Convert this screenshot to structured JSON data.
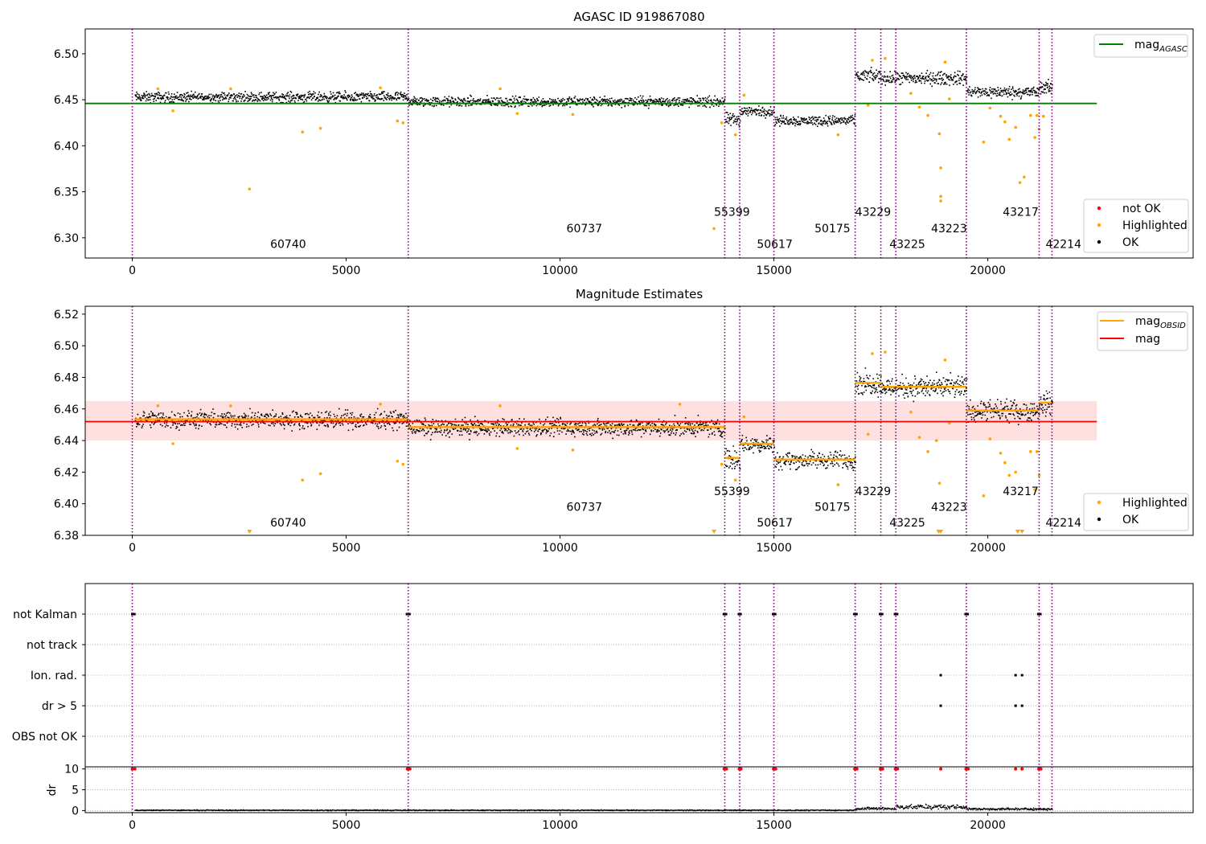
{
  "chart_data": [
    {
      "type": "scatter",
      "title": "AGASC ID 919867080",
      "xlabel": "",
      "ylabel": "",
      "xlim": [
        -1100,
        24800
      ],
      "ylim": [
        6.278,
        6.527
      ],
      "x_ticks": [
        0,
        5000,
        10000,
        15000,
        20000
      ],
      "y_ticks": [
        6.3,
        6.35,
        6.4,
        6.45,
        6.5
      ],
      "grid": false,
      "reference_line": {
        "name": "magAGASC",
        "value": 6.446,
        "color": "#008000",
        "x_range": [
          -1100,
          22550
        ]
      },
      "obsid_boundaries": [
        0,
        6450,
        13850,
        14200,
        15000,
        16900,
        17500,
        17850,
        19500,
        21200,
        21500
      ],
      "obsid_labels": [
        {
          "text": "60740",
          "x": 3225,
          "y": 6.289
        },
        {
          "text": "60737",
          "x": 10150,
          "y": 6.306
        },
        {
          "text": "55399",
          "x": 13600,
          "y": 6.324
        },
        {
          "text": "50617",
          "x": 14600,
          "y": 6.289
        },
        {
          "text": "50175",
          "x": 15950,
          "y": 6.306
        },
        {
          "text": "43229",
          "x": 16900,
          "y": 6.324
        },
        {
          "text": "43225",
          "x": 17700,
          "y": 6.289
        },
        {
          "text": "43223",
          "x": 18675,
          "y": 6.306
        },
        {
          "text": "43217",
          "x": 20350,
          "y": 6.324
        },
        {
          "text": "42214",
          "x": 21350,
          "y": 6.289
        }
      ],
      "segments": [
        {
          "x0": 50,
          "x1": 6450,
          "mean": 6.4535,
          "spread": 0.006
        },
        {
          "x0": 6450,
          "x1": 13850,
          "mean": 6.4485,
          "spread": 0.006
        },
        {
          "x0": 13850,
          "x1": 14200,
          "mean": 6.429,
          "spread": 0.008
        },
        {
          "x0": 14200,
          "x1": 15000,
          "mean": 6.438,
          "spread": 0.006
        },
        {
          "x0": 15000,
          "x1": 16900,
          "mean": 6.428,
          "spread": 0.006
        },
        {
          "x0": 16900,
          "x1": 17500,
          "mean": 6.4765,
          "spread": 0.008
        },
        {
          "x0": 17500,
          "x1": 17850,
          "mean": 6.474,
          "spread": 0.007
        },
        {
          "x0": 17850,
          "x1": 19500,
          "mean": 6.474,
          "spread": 0.008
        },
        {
          "x0": 19500,
          "x1": 21200,
          "mean": 6.459,
          "spread": 0.007
        },
        {
          "x0": 21200,
          "x1": 21500,
          "mean": 6.464,
          "spread": 0.008
        }
      ],
      "highlighted_points": [
        [
          2740,
          6.353
        ],
        [
          3980,
          6.415
        ],
        [
          4400,
          6.419
        ],
        [
          6200,
          6.427
        ],
        [
          6330,
          6.425
        ],
        [
          950,
          6.438
        ],
        [
          13600,
          6.31
        ],
        [
          13780,
          6.425
        ],
        [
          14100,
          6.412
        ],
        [
          14300,
          6.455
        ],
        [
          16500,
          6.412
        ],
        [
          17200,
          6.444
        ],
        [
          18900,
          6.376
        ],
        [
          18900,
          6.345
        ],
        [
          18900,
          6.34
        ],
        [
          18870,
          6.413
        ],
        [
          19100,
          6.451
        ],
        [
          18400,
          6.442
        ],
        [
          18600,
          6.433
        ],
        [
          19900,
          6.404
        ],
        [
          20050,
          6.441
        ],
        [
          20300,
          6.432
        ],
        [
          20400,
          6.426
        ],
        [
          20500,
          6.407
        ],
        [
          20650,
          6.42
        ],
        [
          20750,
          6.36
        ],
        [
          20850,
          6.366
        ],
        [
          21000,
          6.433
        ],
        [
          21100,
          6.409
        ],
        [
          21150,
          6.433
        ],
        [
          21200,
          6.418
        ],
        [
          21300,
          6.432
        ],
        [
          17300,
          6.493
        ],
        [
          17600,
          6.495
        ],
        [
          18200,
          6.457
        ],
        [
          19000,
          6.491
        ],
        [
          9000,
          6.435
        ],
        [
          10300,
          6.434
        ],
        [
          5800,
          6.463
        ],
        [
          600,
          6.462
        ],
        [
          2300,
          6.462
        ],
        [
          8600,
          6.462
        ]
      ],
      "legends": [
        {
          "placement": "upper-right",
          "entries": [
            {
              "label": "magAGASC",
              "kind": "line",
              "color": "#008000"
            }
          ]
        },
        {
          "placement": "lower-right",
          "entries": [
            {
              "label": "not OK",
              "kind": "marker",
              "color": "#ff0000"
            },
            {
              "label": "Highlighted",
              "kind": "marker",
              "color": "#ffa500"
            },
            {
              "label": "OK",
              "kind": "marker",
              "color": "#000000"
            }
          ]
        }
      ]
    },
    {
      "type": "scatter",
      "title": "Magnitude Estimates",
      "xlabel": "",
      "ylabel": "",
      "xlim": [
        -1100,
        24800
      ],
      "ylim": [
        6.38,
        6.525
      ],
      "x_ticks": [
        0,
        5000,
        10000,
        15000,
        20000
      ],
      "y_ticks": [
        6.38,
        6.4,
        6.42,
        6.44,
        6.46,
        6.48,
        6.5,
        6.52
      ],
      "grid": false,
      "mag_line": {
        "name": "mag",
        "value": 6.452,
        "color": "#ff0000",
        "band": [
          6.44,
          6.465
        ],
        "x_range": [
          -1100,
          22550
        ]
      },
      "obsid_boundaries": [
        0,
        6450,
        13850,
        14200,
        15000,
        16900,
        17500,
        17850,
        19500,
        21200,
        21500
      ],
      "obsid_labels": [
        {
          "text": "60740",
          "x": 3225,
          "y": 6.3855
        },
        {
          "text": "60737",
          "x": 10150,
          "y": 6.3955
        },
        {
          "text": "55399",
          "x": 13600,
          "y": 6.4055
        },
        {
          "text": "50617",
          "x": 14600,
          "y": 6.3855
        },
        {
          "text": "50175",
          "x": 15950,
          "y": 6.3955
        },
        {
          "text": "43229",
          "x": 16900,
          "y": 6.4055
        },
        {
          "text": "43225",
          "x": 17700,
          "y": 6.3855
        },
        {
          "text": "43223",
          "x": 18675,
          "y": 6.3955
        },
        {
          "text": "43217",
          "x": 20350,
          "y": 6.4055
        },
        {
          "text": "42214",
          "x": 21350,
          "y": 6.3855
        }
      ],
      "segments": [
        {
          "x0": 50,
          "x1": 6450,
          "mean": 6.4535,
          "spread": 0.006
        },
        {
          "x0": 6450,
          "x1": 13850,
          "mean": 6.4485,
          "spread": 0.006
        },
        {
          "x0": 13850,
          "x1": 14200,
          "mean": 6.429,
          "spread": 0.008
        },
        {
          "x0": 14200,
          "x1": 15000,
          "mean": 6.438,
          "spread": 0.006
        },
        {
          "x0": 15000,
          "x1": 16900,
          "mean": 6.428,
          "spread": 0.006
        },
        {
          "x0": 16900,
          "x1": 17500,
          "mean": 6.4765,
          "spread": 0.008
        },
        {
          "x0": 17500,
          "x1": 17850,
          "mean": 6.474,
          "spread": 0.007
        },
        {
          "x0": 17850,
          "x1": 19500,
          "mean": 6.474,
          "spread": 0.008
        },
        {
          "x0": 19500,
          "x1": 21200,
          "mean": 6.459,
          "spread": 0.007
        },
        {
          "x0": 21200,
          "x1": 21500,
          "mean": 6.464,
          "spread": 0.008
        }
      ],
      "highlighted_points": [
        [
          3980,
          6.415
        ],
        [
          4400,
          6.419
        ],
        [
          6200,
          6.427
        ],
        [
          6330,
          6.425
        ],
        [
          950,
          6.438
        ],
        [
          10300,
          6.434
        ],
        [
          9000,
          6.435
        ],
        [
          13780,
          6.425
        ],
        [
          14100,
          6.415
        ],
        [
          14300,
          6.455
        ],
        [
          16500,
          6.412
        ],
        [
          17200,
          6.444
        ],
        [
          18870,
          6.413
        ],
        [
          19100,
          6.451
        ],
        [
          18400,
          6.442
        ],
        [
          18600,
          6.433
        ],
        [
          18800,
          6.44
        ],
        [
          19900,
          6.405
        ],
        [
          20050,
          6.441
        ],
        [
          20300,
          6.432
        ],
        [
          20400,
          6.426
        ],
        [
          20500,
          6.418
        ],
        [
          20650,
          6.42
        ],
        [
          21000,
          6.433
        ],
        [
          21100,
          6.409
        ],
        [
          21150,
          6.433
        ],
        [
          21200,
          6.418
        ],
        [
          17300,
          6.495
        ],
        [
          17600,
          6.496
        ],
        [
          18200,
          6.458
        ],
        [
          19000,
          6.491
        ],
        [
          5800,
          6.463
        ],
        [
          600,
          6.462
        ],
        [
          2300,
          6.462
        ],
        [
          8600,
          6.462
        ],
        [
          12800,
          6.463
        ]
      ],
      "offscale_points": [
        2740,
        13600,
        18850,
        18900,
        20700,
        20800
      ],
      "legends": [
        {
          "placement": "upper-right",
          "entries": [
            {
              "label": "magOBSID",
              "kind": "line",
              "color": "#ffa500"
            },
            {
              "label": "mag",
              "kind": "line",
              "color": "#ff0000"
            }
          ]
        },
        {
          "placement": "lower-right",
          "entries": [
            {
              "label": "Highlighted",
              "kind": "marker",
              "color": "#ffa500"
            },
            {
              "label": "OK",
              "kind": "marker",
              "color": "#000000"
            }
          ]
        }
      ]
    },
    {
      "type": "scatter",
      "title": "",
      "xlabel": "",
      "ylabel": "",
      "xlim": [
        -1100,
        24800
      ],
      "categories": [
        "not Kalman",
        "not track",
        "Ion. rad.",
        "dr > 5",
        "OBS not OK"
      ],
      "obsid_boundaries": [
        0,
        6450,
        13850,
        14200,
        15000,
        16900,
        17500,
        17850,
        19500,
        21200,
        21500
      ],
      "flag_points": {
        "not Kalman": [
          0,
          50,
          6420,
          6480,
          13830,
          13880,
          14180,
          14220,
          14980,
          15030,
          16880,
          16930,
          17480,
          17530,
          17830,
          17880,
          19480,
          19530,
          21180,
          21230
        ],
        "not track": [],
        "Ion. rad.": [
          18900,
          20650,
          20800
        ],
        "dr > 5": [
          18900,
          20650,
          20800
        ],
        "OBS not OK": []
      }
    },
    {
      "type": "scatter",
      "title": "",
      "xlabel": "",
      "ylabel": "dr",
      "xlim": [
        -1100,
        24800
      ],
      "ylim": [
        -0.5,
        10.5
      ],
      "y_ticks": [
        0,
        5,
        10
      ],
      "x_ticks": [
        0,
        5000,
        10000,
        15000,
        20000
      ],
      "obsid_boundaries": [
        0,
        6450,
        13850,
        14200,
        15000,
        16900,
        17500,
        17850,
        19500,
        21200,
        21500
      ],
      "clipped_points": [
        0,
        60,
        6430,
        6490,
        13840,
        13890,
        14190,
        14230,
        14990,
        15040,
        16890,
        16940,
        17490,
        17540,
        17840,
        17890,
        18900,
        19490,
        19540,
        20650,
        20800,
        21190,
        21240
      ],
      "dr_levels": [
        {
          "x0": 50,
          "x1": 16900,
          "level": 0.2
        },
        {
          "x0": 16900,
          "x1": 17850,
          "level": 0.6
        },
        {
          "x0": 17850,
          "x1": 19500,
          "level": 1.0
        },
        {
          "x0": 19500,
          "x1": 21500,
          "level": 0.5
        }
      ]
    }
  ]
}
